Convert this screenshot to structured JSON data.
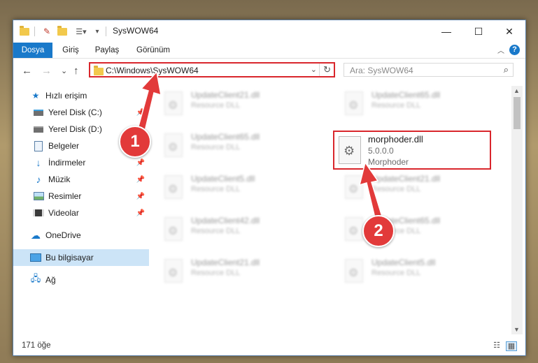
{
  "window": {
    "title": "SysWOW64",
    "controls": {
      "minimize": "—",
      "maximize": "☐",
      "close": "✕"
    }
  },
  "ribbon": {
    "tabs": [
      {
        "label": "Dosya",
        "active": true
      },
      {
        "label": "Giriş",
        "active": false
      },
      {
        "label": "Paylaş",
        "active": false
      },
      {
        "label": "Görünüm",
        "active": false
      }
    ],
    "help": "?"
  },
  "navigation": {
    "back": "←",
    "forward": "→",
    "recent": "⌄",
    "up": "↑",
    "address": "C:\\Windows\\SysWOW64",
    "search_placeholder": "Ara: SysWOW64"
  },
  "nav_pane": {
    "items": [
      {
        "label": "Hızlı erişim",
        "icon": "star-icon",
        "selected": false
      },
      {
        "label": "Yerel Disk (C:)",
        "icon": "drive-icon",
        "selected": false
      },
      {
        "label": "Yerel Disk (D:)",
        "icon": "drive-icon",
        "selected": false
      },
      {
        "label": "Belgeler",
        "icon": "documents-icon",
        "selected": false
      },
      {
        "label": "İndirmeler",
        "icon": "download-icon",
        "selected": false
      },
      {
        "label": "Müzik",
        "icon": "music-icon",
        "selected": false
      },
      {
        "label": "Resimler",
        "icon": "pictures-icon",
        "selected": false
      },
      {
        "label": "Videolar",
        "icon": "videos-icon",
        "selected": false
      },
      {
        "label": "OneDrive",
        "icon": "cloud-icon",
        "selected": false
      },
      {
        "label": "Bu bilgisayar",
        "icon": "computer-icon",
        "selected": true
      },
      {
        "label": "Ağ",
        "icon": "network-icon",
        "selected": false
      }
    ]
  },
  "files": {
    "left_column": [
      {
        "name": "UpdateClient21.dll",
        "desc": "Resource DLL"
      },
      {
        "name": "UpdateClient65.dll",
        "desc": "Resource DLL"
      },
      {
        "name": "UpdateClient5.dll",
        "desc": "Resource DLL"
      },
      {
        "name": "UpdateClient42.dll",
        "desc": "Resource DLL"
      },
      {
        "name": "UpdateClient21.dll",
        "desc": "Resource DLL"
      }
    ],
    "right_column": [
      {
        "name": "UpdateClient65.dll",
        "desc": "Resource DLL"
      },
      {
        "name": "UpdateClient21.dll",
        "desc": "Resource DLL"
      },
      {
        "name": "UpdateClient65.dll",
        "desc": "Resource DLL"
      },
      {
        "name": "UpdateClient5.dll",
        "desc": "Resource DLL"
      }
    ],
    "highlighted": {
      "name": "morphoder.dll",
      "version": "5.0.0.0",
      "desc": "Morphoder"
    }
  },
  "status": {
    "count": "171 öğe"
  },
  "annotations": {
    "step1": "1",
    "step2": "2",
    "color": "#e23a3a"
  }
}
